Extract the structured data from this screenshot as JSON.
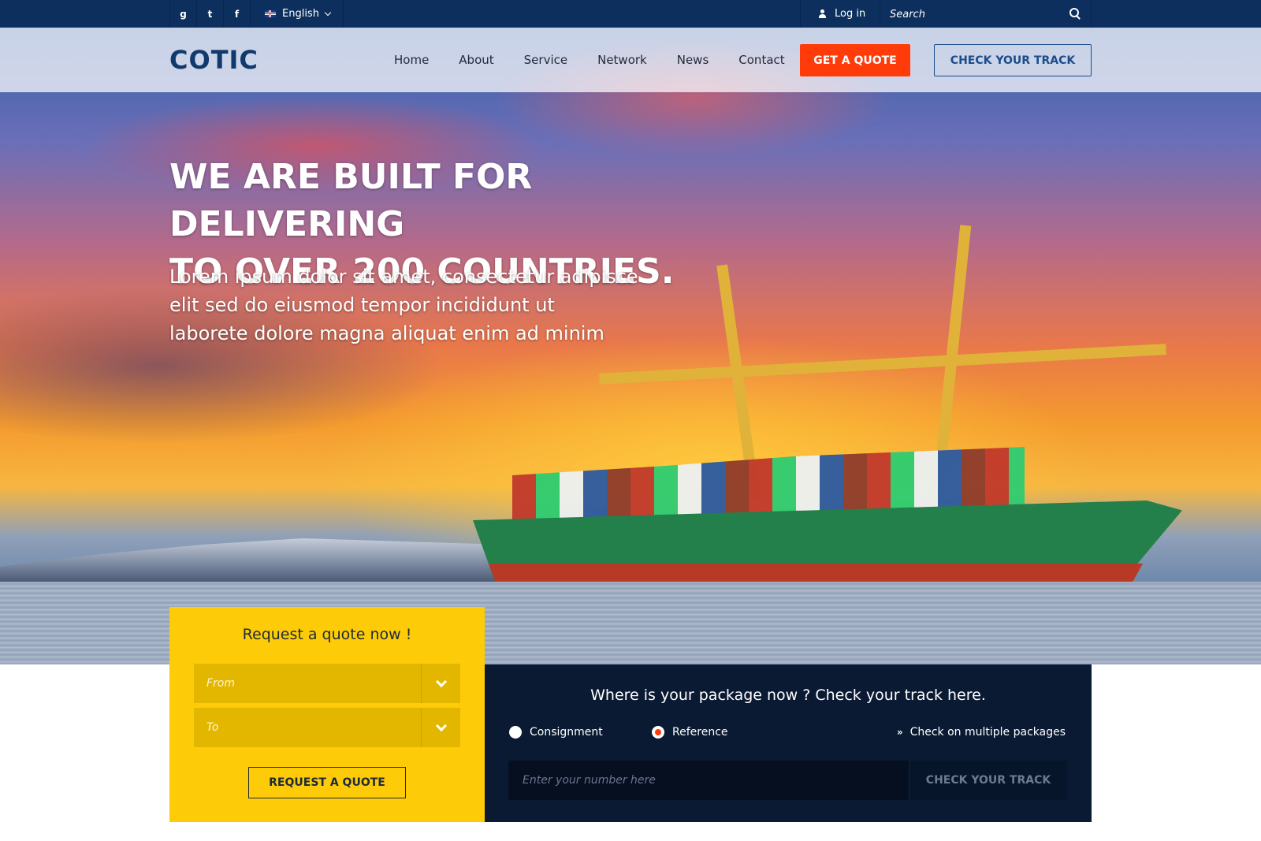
{
  "topbar": {
    "social": [
      {
        "icon": "google-plus-icon",
        "glyph": "g"
      },
      {
        "icon": "twitter-icon",
        "glyph": "t"
      },
      {
        "icon": "facebook-icon",
        "glyph": "f"
      }
    ],
    "language": "English",
    "login_label": "Log in",
    "search_placeholder": "Search"
  },
  "header": {
    "logo": "COTIC",
    "nav": [
      "Home",
      "About",
      "Service",
      "Network",
      "News",
      "Contact"
    ],
    "quote_button": "GET A QUOTE",
    "track_button": "CHECK YOUR TRACK"
  },
  "hero": {
    "title_line1": "WE ARE BUILT FOR DELIVERING",
    "title_line2": "TO OVER 200 COUNTRIES.",
    "text_line1": "Lorem ipsum dolor sit amet, consectetur adipisce",
    "text_line2": "elit sed do eiusmod tempor incididunt ut",
    "text_line3": "laborete dolore magna aliquat enim ad minim"
  },
  "quote_box": {
    "title": "Request a quote now !",
    "from_placeholder": "From",
    "to_placeholder": "To",
    "button": "REQUEST A QUOTE"
  },
  "track_box": {
    "title": "Where is your package now ? Check your track here.",
    "option_consignment": "Consignment",
    "option_reference": "Reference",
    "selected_option": "Reference",
    "multi_link": "Check on multiple packages",
    "input_placeholder": "Enter your number here",
    "button": "CHECK YOUR TRACK"
  },
  "colors": {
    "topbar": "#0d2f5d",
    "accent_orange": "#ff3b0a",
    "quote_yellow": "#fdcb08",
    "track_navy": "#0a1a33",
    "brand_blue": "#103a6d"
  }
}
